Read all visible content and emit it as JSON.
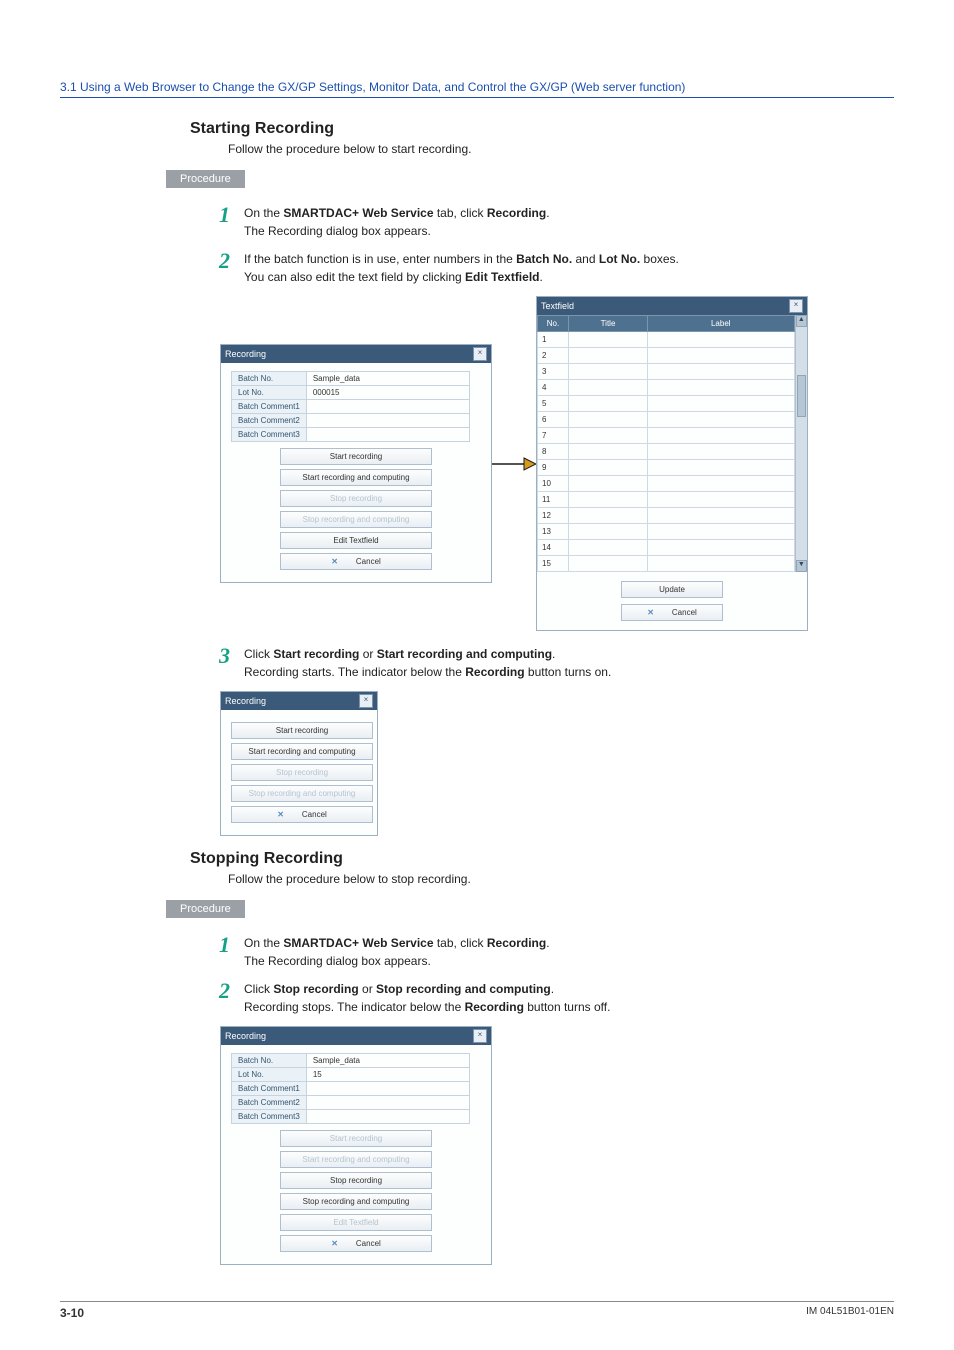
{
  "header": {
    "breadcrumb": "3.1  Using a Web Browser to Change the GX/GP Settings, Monitor Data, and Control the GX/GP (Web server function)"
  },
  "section1": {
    "title": "Starting Recording",
    "intro": "Follow the procedure below to start recording.",
    "procedure_label": "Procedure",
    "steps": {
      "s1": {
        "num": "1",
        "pre": "On the ",
        "b1": "SMARTDAC+ Web Service",
        "mid": " tab, click ",
        "b2": "Recording",
        "post": ".",
        "line2": "The Recording dialog box appears."
      },
      "s2": {
        "num": "2",
        "pre": "If the batch function is in use, enter numbers in the ",
        "b1": "Batch No.",
        "mid": " and ",
        "b2": "Lot No.",
        "post": " boxes.",
        "line2a": "You can also edit the text field by clicking ",
        "line2b": "Edit Textfield",
        "line2c": "."
      },
      "s3": {
        "num": "3",
        "pre": "Click ",
        "b1": "Start recording",
        "mid": " or ",
        "b2": "Start recording and computing",
        "post": ".",
        "line2a": "Recording starts. The indicator below the ",
        "line2b": "Recording",
        "line2c": " button turns on."
      }
    }
  },
  "dialog_recording": {
    "title": "Recording",
    "rows": {
      "batch_no": "Batch No.",
      "lot_no": "Lot No.",
      "bc1": "Batch Comment1",
      "bc2": "Batch Comment2",
      "bc3": "Batch Comment3",
      "batch_val": "Sample_data",
      "lot_val": "000015"
    },
    "buttons": {
      "start": "Start recording",
      "start_comp": "Start recording and computing",
      "stop": "Stop recording",
      "stop_comp": "Stop recording and computing",
      "edit_tf": "Edit Textfield",
      "cancel": "Cancel"
    }
  },
  "dialog_textfield": {
    "title": "Textfield",
    "cols": {
      "no": "No.",
      "title": "Title",
      "label": "Label"
    },
    "numbers": [
      "1",
      "2",
      "3",
      "4",
      "5",
      "6",
      "7",
      "8",
      "9",
      "10",
      "11",
      "12",
      "13",
      "14",
      "15"
    ],
    "buttons": {
      "update": "Update",
      "cancel": "Cancel"
    }
  },
  "section2": {
    "title": "Stopping Recording",
    "intro": "Follow the procedure below to stop recording.",
    "procedure_label": "Procedure",
    "steps": {
      "s1": {
        "num": "1",
        "pre": "On the ",
        "b1": "SMARTDAC+ Web Service",
        "mid": " tab, click ",
        "b2": "Recording",
        "post": ".",
        "line2": "The Recording dialog box appears."
      },
      "s2": {
        "num": "2",
        "pre": "Click ",
        "b1": "Stop recording",
        "mid": " or ",
        "b2": "Stop recording and computing",
        "post": ".",
        "line2a": "Recording stops. The indicator below the ",
        "line2b": "Recording",
        "line2c": " button turns off."
      }
    }
  },
  "dialog_stop": {
    "lot_val": "15"
  },
  "footer": {
    "page": "3-10",
    "doc": "IM 04L51B01-01EN"
  }
}
